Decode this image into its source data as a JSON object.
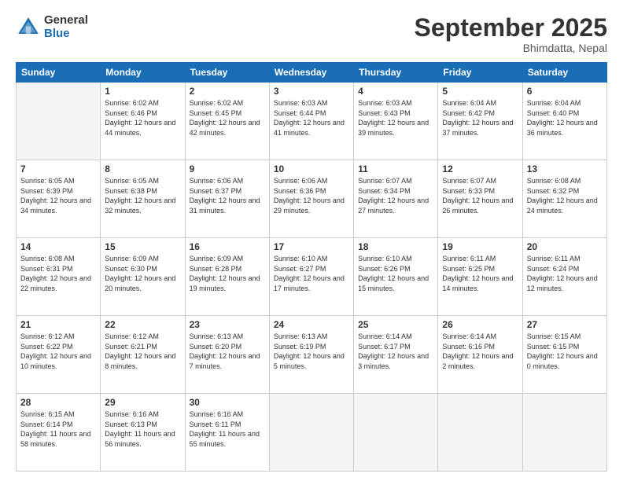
{
  "header": {
    "logo_general": "General",
    "logo_blue": "Blue",
    "month_title": "September 2025",
    "location": "Bhimdatta, Nepal"
  },
  "weekdays": [
    "Sunday",
    "Monday",
    "Tuesday",
    "Wednesday",
    "Thursday",
    "Friday",
    "Saturday"
  ],
  "weeks": [
    [
      {
        "day": "",
        "sunrise": "",
        "sunset": "",
        "daylight": ""
      },
      {
        "day": "1",
        "sunrise": "6:02 AM",
        "sunset": "6:46 PM",
        "daylight": "12 hours and 44 minutes."
      },
      {
        "day": "2",
        "sunrise": "6:02 AM",
        "sunset": "6:45 PM",
        "daylight": "12 hours and 42 minutes."
      },
      {
        "day": "3",
        "sunrise": "6:03 AM",
        "sunset": "6:44 PM",
        "daylight": "12 hours and 41 minutes."
      },
      {
        "day": "4",
        "sunrise": "6:03 AM",
        "sunset": "6:43 PM",
        "daylight": "12 hours and 39 minutes."
      },
      {
        "day": "5",
        "sunrise": "6:04 AM",
        "sunset": "6:42 PM",
        "daylight": "12 hours and 37 minutes."
      },
      {
        "day": "6",
        "sunrise": "6:04 AM",
        "sunset": "6:40 PM",
        "daylight": "12 hours and 36 minutes."
      }
    ],
    [
      {
        "day": "7",
        "sunrise": "6:05 AM",
        "sunset": "6:39 PM",
        "daylight": "12 hours and 34 minutes."
      },
      {
        "day": "8",
        "sunrise": "6:05 AM",
        "sunset": "6:38 PM",
        "daylight": "12 hours and 32 minutes."
      },
      {
        "day": "9",
        "sunrise": "6:06 AM",
        "sunset": "6:37 PM",
        "daylight": "12 hours and 31 minutes."
      },
      {
        "day": "10",
        "sunrise": "6:06 AM",
        "sunset": "6:36 PM",
        "daylight": "12 hours and 29 minutes."
      },
      {
        "day": "11",
        "sunrise": "6:07 AM",
        "sunset": "6:34 PM",
        "daylight": "12 hours and 27 minutes."
      },
      {
        "day": "12",
        "sunrise": "6:07 AM",
        "sunset": "6:33 PM",
        "daylight": "12 hours and 26 minutes."
      },
      {
        "day": "13",
        "sunrise": "6:08 AM",
        "sunset": "6:32 PM",
        "daylight": "12 hours and 24 minutes."
      }
    ],
    [
      {
        "day": "14",
        "sunrise": "6:08 AM",
        "sunset": "6:31 PM",
        "daylight": "12 hours and 22 minutes."
      },
      {
        "day": "15",
        "sunrise": "6:09 AM",
        "sunset": "6:30 PM",
        "daylight": "12 hours and 20 minutes."
      },
      {
        "day": "16",
        "sunrise": "6:09 AM",
        "sunset": "6:28 PM",
        "daylight": "12 hours and 19 minutes."
      },
      {
        "day": "17",
        "sunrise": "6:10 AM",
        "sunset": "6:27 PM",
        "daylight": "12 hours and 17 minutes."
      },
      {
        "day": "18",
        "sunrise": "6:10 AM",
        "sunset": "6:26 PM",
        "daylight": "12 hours and 15 minutes."
      },
      {
        "day": "19",
        "sunrise": "6:11 AM",
        "sunset": "6:25 PM",
        "daylight": "12 hours and 14 minutes."
      },
      {
        "day": "20",
        "sunrise": "6:11 AM",
        "sunset": "6:24 PM",
        "daylight": "12 hours and 12 minutes."
      }
    ],
    [
      {
        "day": "21",
        "sunrise": "6:12 AM",
        "sunset": "6:22 PM",
        "daylight": "12 hours and 10 minutes."
      },
      {
        "day": "22",
        "sunrise": "6:12 AM",
        "sunset": "6:21 PM",
        "daylight": "12 hours and 8 minutes."
      },
      {
        "day": "23",
        "sunrise": "6:13 AM",
        "sunset": "6:20 PM",
        "daylight": "12 hours and 7 minutes."
      },
      {
        "day": "24",
        "sunrise": "6:13 AM",
        "sunset": "6:19 PM",
        "daylight": "12 hours and 5 minutes."
      },
      {
        "day": "25",
        "sunrise": "6:14 AM",
        "sunset": "6:17 PM",
        "daylight": "12 hours and 3 minutes."
      },
      {
        "day": "26",
        "sunrise": "6:14 AM",
        "sunset": "6:16 PM",
        "daylight": "12 hours and 2 minutes."
      },
      {
        "day": "27",
        "sunrise": "6:15 AM",
        "sunset": "6:15 PM",
        "daylight": "12 hours and 0 minutes."
      }
    ],
    [
      {
        "day": "28",
        "sunrise": "6:15 AM",
        "sunset": "6:14 PM",
        "daylight": "11 hours and 58 minutes."
      },
      {
        "day": "29",
        "sunrise": "6:16 AM",
        "sunset": "6:13 PM",
        "daylight": "11 hours and 56 minutes."
      },
      {
        "day": "30",
        "sunrise": "6:16 AM",
        "sunset": "6:11 PM",
        "daylight": "11 hours and 55 minutes."
      },
      {
        "day": "",
        "sunrise": "",
        "sunset": "",
        "daylight": ""
      },
      {
        "day": "",
        "sunrise": "",
        "sunset": "",
        "daylight": ""
      },
      {
        "day": "",
        "sunrise": "",
        "sunset": "",
        "daylight": ""
      },
      {
        "day": "",
        "sunrise": "",
        "sunset": "",
        "daylight": ""
      }
    ]
  ]
}
